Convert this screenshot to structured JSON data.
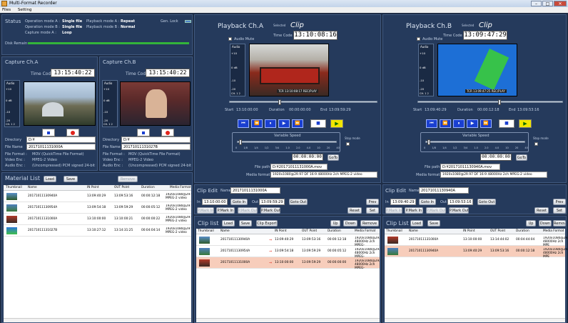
{
  "window": {
    "title": "Multi-Format Recorder",
    "menu": [
      "Files",
      "Setting"
    ]
  },
  "status": {
    "title": "Status",
    "op_a_label": "Operation mode A :",
    "op_a": "Single file",
    "op_b_label": "Operation mode B :",
    "op_b": "Single file",
    "pb_a_label": "Playback mode A :",
    "pb_a": "Repeat",
    "pb_b_label": "Playback mode B :",
    "pb_b": "Normal",
    "capture_label": "Capture mode A :",
    "capture": "Loop",
    "genlock": "Gen. Lock",
    "disk": "Disk Remain"
  },
  "capture_a": {
    "title": "Capture Ch.A",
    "tc_label": "Time Code",
    "tc": "13:15:40:22",
    "directory_label": "Directory",
    "directory": "D:¥",
    "filename_label": "File Name",
    "filename": "20171011131000A",
    "format_label": "File Format :",
    "format": "MOV (QuickTime File Format)",
    "venc_label": "Video Enc :",
    "venc": "MPEG-2 Video",
    "aenc_label": "Audio Enc :",
    "aenc": "(Uncompressed) PCM signed 24-bit little",
    "audio": "Audio",
    "ch": "CH. 1 2",
    "meter": [
      "+10",
      "0 dB",
      "-10",
      "-20"
    ]
  },
  "capture_b": {
    "title": "Capture Ch.B",
    "tc_label": "Time Code",
    "tc": "13:15:40:22",
    "directory_label": "Directory",
    "directory": "D:¥",
    "filename_label": "File Name",
    "filename": "20171011131027B",
    "format_label": "File Format :",
    "format": "MOV (QuickTime File Format)",
    "venc_label": "Video Enc :",
    "venc": "MPEG-2 Video",
    "aenc_label": "Audio Enc :",
    "aenc": "(Uncompressed) PCM signed 24-bit little",
    "audio": "Audio",
    "ch": "CH. 1 2",
    "meter": [
      "+10",
      "0 dB",
      "-10",
      "-20"
    ]
  },
  "material": {
    "title": "Material List",
    "load": "Load",
    "save": "Save",
    "remove": "Remove",
    "cols": [
      "Thumbnail",
      "Name",
      "IN Point",
      "OUT Point",
      "Duration",
      "Media Format"
    ],
    "rows": [
      [
        "20171011130940A",
        "13:09:40:29",
        "13:09:53:16",
        "00:00:12:18",
        "1920x1080@29.97 MPEG-2 video"
      ],
      [
        "20171011130954A",
        "13:09:54:18",
        "13:09:59:29",
        "00:00:05:12",
        "1920x1080@29.97 MPEG-2 video"
      ],
      [
        "20171011131000A",
        "13:10:00:00",
        "13:10:00:21",
        "00:00:00:22",
        "1920x1080@29.97 MPEG-2 video"
      ],
      [
        "20171011131027B",
        "13:10:27:12",
        "13:14:31:25",
        "00:04:04:14",
        "1920x1080@29.97 MPEG-2 video"
      ]
    ]
  },
  "play_a": {
    "title": "Playback Ch.A",
    "selected": "Selected",
    "clip": "Clip",
    "mute": "Audio Mute",
    "tc_label": "Time Code",
    "tc": "13:10:08:16",
    "start_label": "Start",
    "start": "13:10:00:00",
    "dur_label": "Duration",
    "dur": "00:00:00:00",
    "end_label": "End",
    "end": "13:09:59:29",
    "speed": "Variable Speed",
    "ticks": [
      "0",
      "1/8",
      "1/4",
      "1/2",
      "3/4",
      "1.0",
      "2.0",
      "4.0",
      "10",
      "20",
      "40"
    ],
    "stopmode": "Stop mode",
    "goto_tc": "00:00:00:00",
    "goto": "GoTo",
    "filepath_label": "File path",
    "filepath": "D:¥20171011131000A.mov",
    "media_label": "Media format",
    "media": "1920x1080@29.97 DF 16:9 48000Hz 2ch MPEG-2 video",
    "overlay": "TCR 13:10:08:17 REC/PLAY"
  },
  "play_b": {
    "title": "Playback Ch.B",
    "selected": "Selected",
    "clip": "Clip",
    "mute": "Audio Mute",
    "tc_label": "Time Code",
    "tc": "13:09:47:29",
    "start_label": "Start",
    "start": "13:09:40:29",
    "dur_label": "Duration",
    "dur": "00:00:12:18",
    "end_label": "End",
    "end": "13:09:53:16",
    "speed": "Variable Speed",
    "ticks": [
      "0",
      "1/8",
      "1/4",
      "1/2",
      "3/4",
      "1.0",
      "2.0",
      "4.0",
      "10",
      "20",
      "40"
    ],
    "stopmode": "Stop mode",
    "goto_tc": "00:00:00:00",
    "goto": "GoTo",
    "filepath_label": "File path",
    "filepath": "D:¥20171011130940A.mov",
    "media_label": "Media format",
    "media": "1920x1080@29.97 DF 16:9 48000Hz 2ch MPEG-2 video",
    "overlay": "TCR 13:09:47:25 REC/PLAY"
  },
  "edit_a": {
    "title": "Clip Edit",
    "name_label": "Name",
    "name": "20171011131000A",
    "in_label": "In",
    "in": "13:10:00:00",
    "goto_in": "Goto In",
    "out_label": "Out",
    "out": "13:09:59:29",
    "goto_out": "Goto Out",
    "prev": "Prev",
    "reset": "Reset",
    "set": "Set",
    "b1": "P.Mark In",
    "b2": "P.Mark In",
    "b3": "P.Mark Out",
    "b4": "P.Mark Out"
  },
  "edit_b": {
    "title": "Clip Edit",
    "name_label": "Name",
    "name": "20171011130940A",
    "in_label": "In",
    "in": "13:09:40:29",
    "goto_in": "Goto In",
    "out_label": "Out",
    "out": "13:09:53:16",
    "goto_out": "Goto Out",
    "prev": "Prev",
    "reset": "Reset",
    "set": "Set",
    "b1": "P.Mark In",
    "b2": "P.Mark In",
    "b3": "P.Mark Out",
    "b4": "P.Mark Out"
  },
  "clips_a": {
    "title": "Clip list",
    "load": "Load",
    "save": "Save",
    "export": "Clip Export",
    "up": "Up",
    "down": "Down",
    "remove": "Remove",
    "cols": [
      "Thumbnail",
      "Name",
      "IN Point",
      "OUT Point",
      "Duration",
      "Media Format"
    ],
    "rows": [
      [
        "20171011130940A",
        "13:09:40:29",
        "13:09:53:16",
        "00:00:12:18",
        "1920x1080@29.97 48000Hz 2ch MPEG-"
      ],
      [
        "20171011130954A",
        "13:09:54:18",
        "13:09:59:29",
        "00:00:05:12",
        "1920x1080@29.97 48000Hz 2ch MPEG-"
      ],
      [
        "20171011131000A",
        "13:10:00:00",
        "13:09:59:29",
        "00:00:00:00",
        "1920x1080@29.97 48000Hz 2ch MPEG-"
      ]
    ]
  },
  "clips_b": {
    "title": "Clip List",
    "load": "Load",
    "save": "Save",
    "up": "Up",
    "down": "Down",
    "remove": "Remove",
    "cols": [
      "Thumbnail",
      "Name",
      "IN Point",
      "OUT Point",
      "Duration",
      "Media Format"
    ],
    "rows": [
      [
        "20171011131000A",
        "13:10:00:00",
        "13:14:44:02",
        "00:04:44:04",
        "1920x1080@29.97 48000Hz 2ch MPE"
      ],
      [
        "20171011130940A",
        "13:09:40:29",
        "13:09:53:16",
        "00:00:12:18",
        "1920x1080@29.97 48000Hz 2ch MPE"
      ]
    ]
  }
}
